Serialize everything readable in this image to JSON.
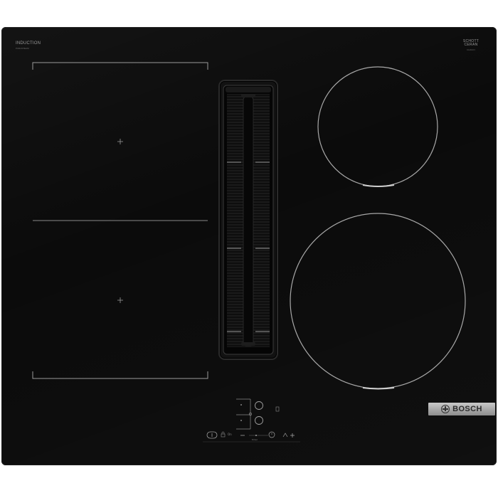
{
  "cooktop": {
    "top_left_label": "INDUCTION",
    "top_left_sublabel": "PURASTEAM",
    "top_right_label_line1": "SCHOTT",
    "top_right_label_line2": "CERAN",
    "top_right_sublabel": "CERAN",
    "brand": "BOSCH"
  },
  "controls": {
    "power_label": "On",
    "timer_label": "timer"
  }
}
